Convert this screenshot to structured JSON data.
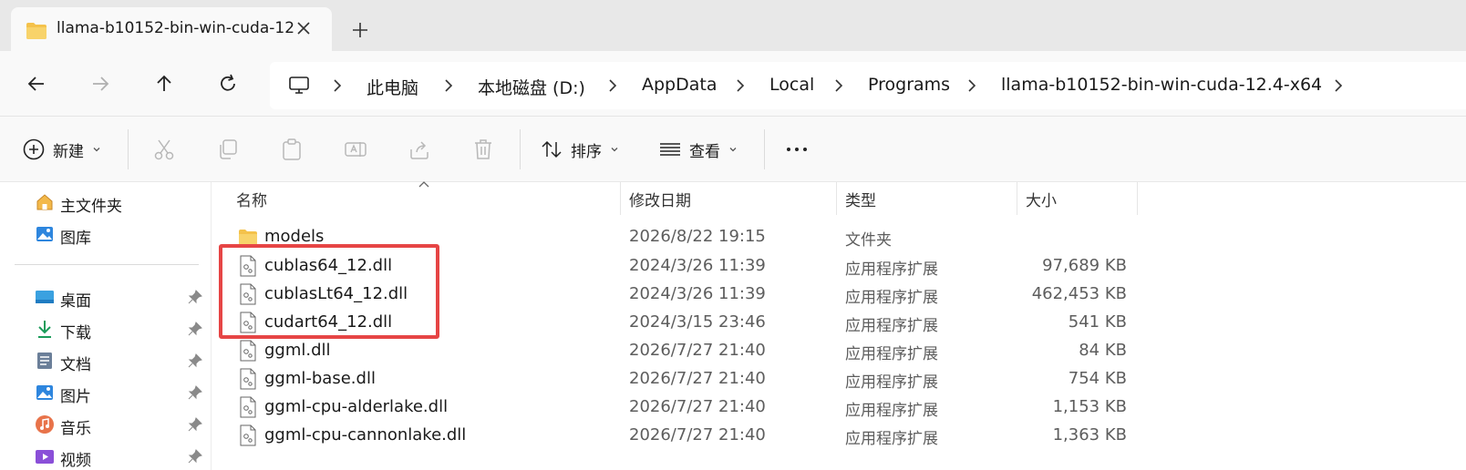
{
  "tab": {
    "title": "llama-b10152-bin-win-cuda-12"
  },
  "breadcrumb": [
    "此电脑",
    "本地磁盘 (D:)",
    "AppData",
    "Local",
    "Programs",
    "llama-b10152-bin-win-cuda-12.4-x64"
  ],
  "toolbar": {
    "new_label": "新建",
    "sort_label": "排序",
    "view_label": "查看"
  },
  "sidebar": {
    "top_items": [
      {
        "label": "主文件夹",
        "icon": "home-icon"
      },
      {
        "label": "图库",
        "icon": "gallery-icon"
      }
    ],
    "pinned_items": [
      {
        "label": "桌面",
        "icon": "desktop-icon"
      },
      {
        "label": "下载",
        "icon": "download-icon"
      },
      {
        "label": "文档",
        "icon": "documents-icon"
      },
      {
        "label": "图片",
        "icon": "pictures-icon"
      },
      {
        "label": "音乐",
        "icon": "music-icon"
      },
      {
        "label": "视频",
        "icon": "video-icon"
      }
    ]
  },
  "columns": {
    "name": "名称",
    "date": "修改日期",
    "type": "类型",
    "size": "大小"
  },
  "files": [
    {
      "name": "models",
      "date": "2026/8/22 19:15",
      "type": "文件夹",
      "size": "",
      "kind": "folder"
    },
    {
      "name": "cublas64_12.dll",
      "date": "2024/3/26 11:39",
      "type": "应用程序扩展",
      "size": "97,689 KB",
      "kind": "dll"
    },
    {
      "name": "cublasLt64_12.dll",
      "date": "2024/3/26 11:39",
      "type": "应用程序扩展",
      "size": "462,453 KB",
      "kind": "dll"
    },
    {
      "name": "cudart64_12.dll",
      "date": "2024/3/15 23:46",
      "type": "应用程序扩展",
      "size": "541 KB",
      "kind": "dll"
    },
    {
      "name": "ggml.dll",
      "date": "2026/7/27 21:40",
      "type": "应用程序扩展",
      "size": "84 KB",
      "kind": "dll"
    },
    {
      "name": "ggml-base.dll",
      "date": "2026/7/27 21:40",
      "type": "应用程序扩展",
      "size": "754 KB",
      "kind": "dll"
    },
    {
      "name": "ggml-cpu-alderlake.dll",
      "date": "2026/7/27 21:40",
      "type": "应用程序扩展",
      "size": "1,153 KB",
      "kind": "dll"
    },
    {
      "name": "ggml-cpu-cannonlake.dll",
      "date": "2026/7/27 21:40",
      "type": "应用程序扩展",
      "size": "1,363 KB",
      "kind": "dll"
    }
  ],
  "colors": {
    "highlight": "#e64545",
    "folder": "#f4c24b"
  }
}
